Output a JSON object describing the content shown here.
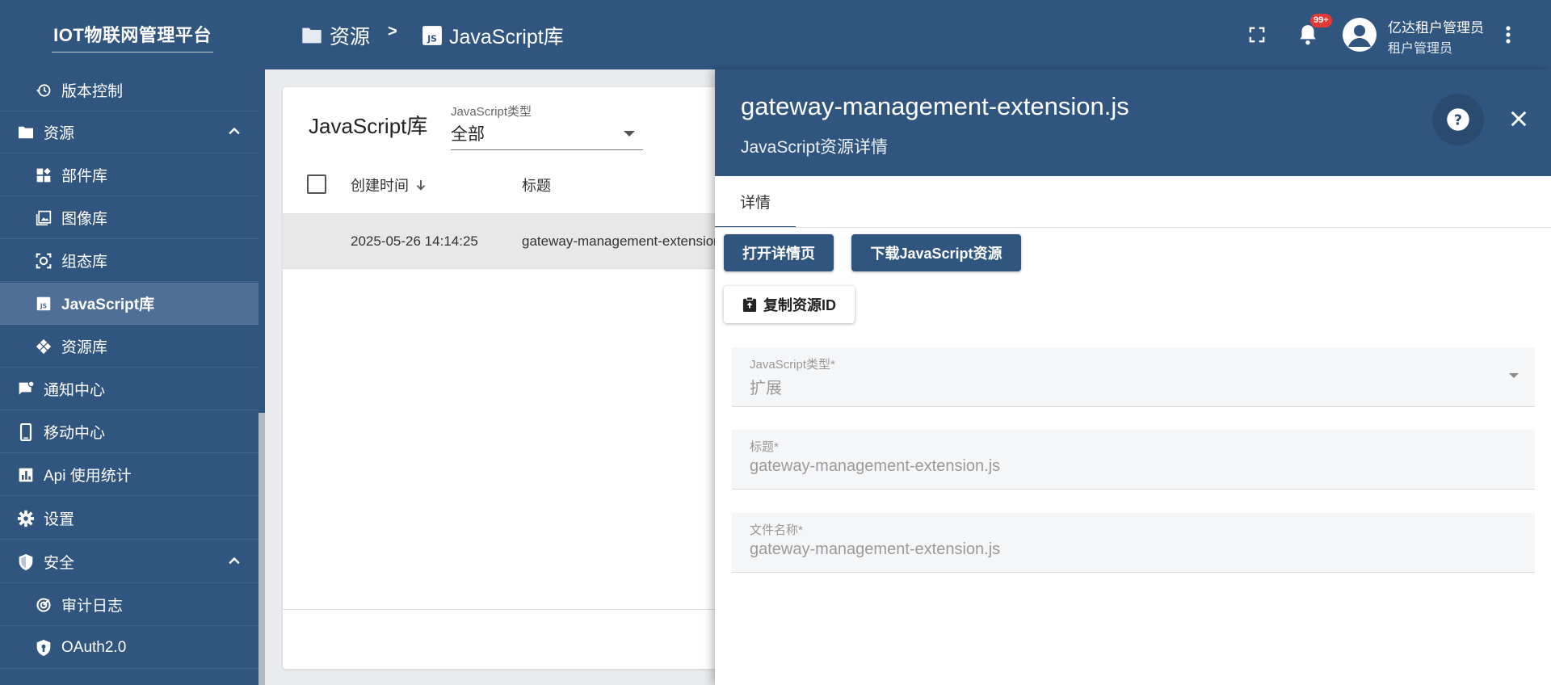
{
  "header": {
    "logo": "IOT物联网管理平台",
    "breadcrumb": {
      "root": "资源",
      "separator": ">",
      "current": "JavaScript库"
    },
    "notification_badge": "99+",
    "user_name": "亿达租户管理员",
    "user_role": "租户管理员"
  },
  "sidebar": {
    "items": [
      {
        "label": "版本控制",
        "icon": "history-icon"
      },
      {
        "label": "资源",
        "icon": "folder-icon"
      },
      {
        "label": "部件库",
        "icon": "widgets-icon"
      },
      {
        "label": "图像库",
        "icon": "image-icon"
      },
      {
        "label": "组态库",
        "icon": "scada-icon"
      },
      {
        "label": "JavaScript库",
        "icon": "js-icon"
      },
      {
        "label": "资源库",
        "icon": "resource-icon"
      },
      {
        "label": "通知中心",
        "icon": "notification-icon"
      },
      {
        "label": "移动中心",
        "icon": "mobile-icon"
      },
      {
        "label": "Api 使用统计",
        "icon": "chart-icon"
      },
      {
        "label": "设置",
        "icon": "gear-icon"
      },
      {
        "label": "安全",
        "icon": "shield-icon"
      },
      {
        "label": "审计日志",
        "icon": "audit-icon"
      },
      {
        "label": "OAuth2.0",
        "icon": "oauth-icon"
      }
    ]
  },
  "main": {
    "title": "JavaScript库",
    "filter_label": "JavaScript类型",
    "filter_value": "全部",
    "columns": {
      "created": "创建时间",
      "title": "标题"
    },
    "rows": [
      {
        "created": "2025-05-26 14:14:25",
        "title": "gateway-management-extension.js"
      }
    ]
  },
  "drawer": {
    "title": "gateway-management-extension.js",
    "subtitle": "JavaScript资源详情",
    "tab": "详情",
    "open_button": "打开详情页",
    "download_button": "下载JavaScript资源",
    "copy_button": "复制资源ID",
    "fields": {
      "type": {
        "label": "JavaScript类型*",
        "value": "扩展"
      },
      "title": {
        "label": "标题*",
        "value": "gateway-management-extension.js"
      },
      "filename": {
        "label": "文件名称*",
        "value": "gateway-management-extension.js"
      }
    }
  },
  "colors": {
    "primary": "#305680",
    "active_item": "#4f6f97",
    "badge": "#e53935"
  }
}
